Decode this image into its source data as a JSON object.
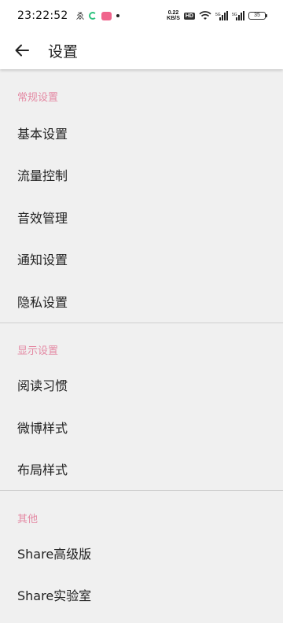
{
  "status_bar": {
    "time": "23:22:52",
    "net_speed_value": "0.22",
    "net_speed_unit": "KB/S",
    "hd_label": "HD",
    "battery_level": "35"
  },
  "app_bar": {
    "title": "设置"
  },
  "sections": [
    {
      "header": "常规设置",
      "items": [
        "基本设置",
        "流量控制",
        "音效管理",
        "通知设置",
        "隐私设置"
      ]
    },
    {
      "header": "显示设置",
      "items": [
        "阅读习惯",
        "微博样式",
        "布局样式"
      ]
    },
    {
      "header": "其他",
      "items": [
        "Share高级版",
        "Share实验室"
      ]
    }
  ],
  "colors": {
    "section_header": "#e48aa4",
    "background": "#f0f0f0",
    "app_bar": "#ffffff"
  }
}
